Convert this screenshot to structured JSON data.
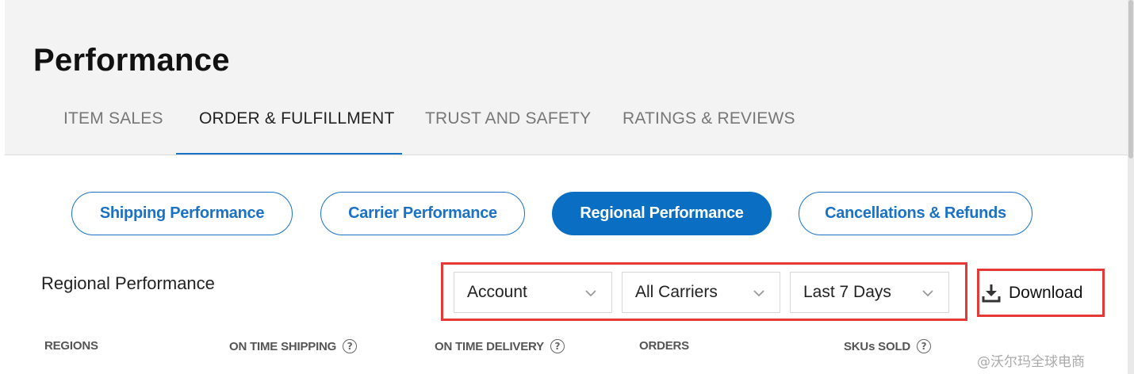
{
  "page": {
    "title": "Performance"
  },
  "tabs": [
    {
      "label": "ITEM SALES",
      "active": false
    },
    {
      "label": "ORDER & FULFILLMENT",
      "active": true
    },
    {
      "label": "TRUST AND SAFETY",
      "active": false
    },
    {
      "label": "RATINGS & REVIEWS",
      "active": false
    }
  ],
  "subtabs": [
    {
      "label": "Shipping Performance",
      "active": false
    },
    {
      "label": "Carrier Performance",
      "active": false
    },
    {
      "label": "Regional Performance",
      "active": true
    },
    {
      "label": "Cancellations & Refunds",
      "active": false
    }
  ],
  "section": {
    "title": "Regional Performance"
  },
  "filters": [
    {
      "value": "Account"
    },
    {
      "value": "All Carriers"
    },
    {
      "value": "Last 7 Days"
    }
  ],
  "download": {
    "label": "Download",
    "icon": "download-icon"
  },
  "table": {
    "columns": [
      {
        "label": "REGIONS",
        "help": false
      },
      {
        "label": "ON TIME SHIPPING",
        "help": true
      },
      {
        "label": "ON TIME DELIVERY",
        "help": true
      },
      {
        "label": "ORDERS",
        "help": false
      },
      {
        "label": "SKUs SOLD",
        "help": true
      }
    ]
  },
  "help_icon_glyph": "?",
  "watermark": "@沃尔玛全球电商",
  "colors": {
    "accent": "#1a72c6",
    "highlight": "#e53935"
  }
}
